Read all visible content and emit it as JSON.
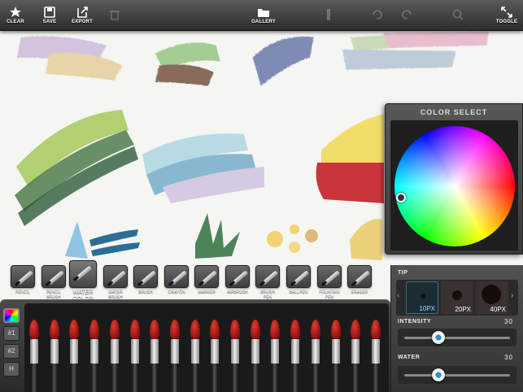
{
  "toolbar": {
    "clear": "CLEAR",
    "save": "SAVE",
    "export": "EXPORT",
    "gallery": "GALLERY",
    "toggle": "TOGGLE"
  },
  "color_select": {
    "title": "COLOR SELECT"
  },
  "tools": [
    {
      "label": "PENCIL"
    },
    {
      "label": "PENCIL\nBRUSH"
    },
    {
      "label": "WATER\nCOLOR"
    },
    {
      "label": "WATER\nBRUSH"
    },
    {
      "label": "BRUSH"
    },
    {
      "label": "CRAYON"
    },
    {
      "label": "MARKER"
    },
    {
      "label": "AIRBRUSH"
    },
    {
      "label": "BRUSH\nPEN"
    },
    {
      "label": "BALLPEN"
    },
    {
      "label": "FOUNTAIN\nPEN"
    },
    {
      "label": "ERASER"
    }
  ],
  "selected_tool": "WATER\nCOLOR",
  "swatches": [
    "#1",
    "#2",
    "H"
  ],
  "brush_color": "#c0221b",
  "tip": {
    "label": "TIP",
    "sizes": [
      "10PX",
      "20PX",
      "40PX"
    ],
    "selected": "10PX"
  },
  "intensity": {
    "label": "INTENSITY",
    "value": "30",
    "fraction": 0.3
  },
  "water": {
    "label": "WATER",
    "value": "30",
    "fraction": 0.3
  }
}
